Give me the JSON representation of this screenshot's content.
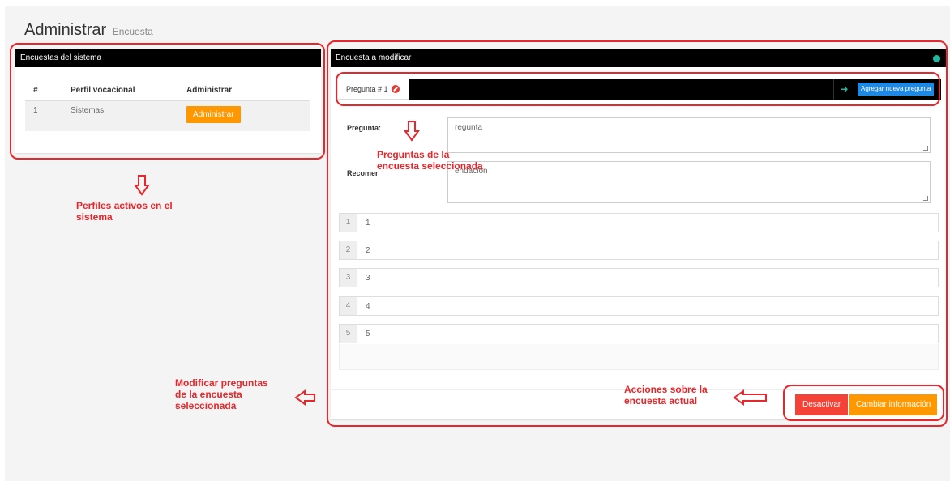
{
  "header": {
    "title": "Administrar",
    "subtitle": "Encuesta"
  },
  "left_panel": {
    "title": "Encuestas del sistema",
    "columns": [
      "#",
      "Perfil vocacional",
      "Administrar"
    ],
    "rows": [
      {
        "num": "1",
        "profile": "Sistemas",
        "action_label": "Administrar"
      }
    ]
  },
  "right_panel": {
    "title": "Encuesta a modificar",
    "tab_label": "Pregunta # 1",
    "add_question_label": "Agregar nueva pregunta",
    "question_label": "Pregunta:",
    "question_value": "regunta",
    "recommendation_label": "Recomer",
    "recommendation_value": "endacion",
    "options": [
      {
        "num": "1",
        "value": "1"
      },
      {
        "num": "2",
        "value": "2"
      },
      {
        "num": "3",
        "value": "3"
      },
      {
        "num": "4",
        "value": "4"
      },
      {
        "num": "5",
        "value": "5"
      }
    ],
    "deactivate_label": "Desactivar",
    "change_info_label": "Cambiar información"
  },
  "annotations": {
    "profiles": "Perfiles activos en el sistema",
    "questions": "Preguntas de la encuesta seleccionada",
    "modify": "Modificar preguntas de la encuesta seleccionada",
    "actions": "Acciones sobre la encuesta actual"
  },
  "colors": {
    "accent_orange": "#ff9800",
    "accent_red": "#f44336",
    "accent_blue": "#1e88e5",
    "annotation_red": "#e8262b",
    "teal": "#22b8a0"
  }
}
